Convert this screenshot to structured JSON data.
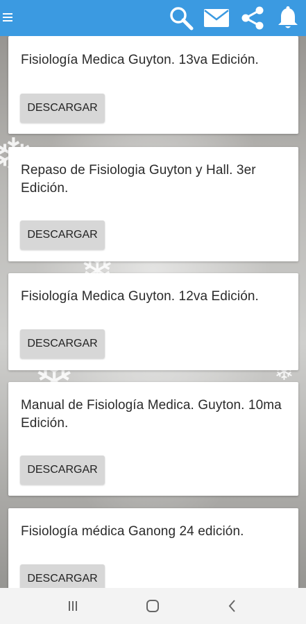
{
  "toolbar": {
    "icons": [
      "menu-icon",
      "search-icon",
      "mail-icon",
      "share-icon",
      "bell-icon"
    ],
    "color": "#3b9ae1"
  },
  "books": [
    {
      "title": "Fisiología Medica Guyton. 13va Edición.",
      "button": "DESCARGAR"
    },
    {
      "title": "Repaso de Fisiologia Guyton y Hall. 3er Edición.",
      "button": "DESCARGAR"
    },
    {
      "title": "Fisiología Medica Guyton. 12va Edición.",
      "button": "DESCARGAR"
    },
    {
      "title": "Manual de Fisiología Medica. Guyton. 10ma Edición.",
      "button": "DESCARGAR"
    },
    {
      "title": "Fisiología médica Ganong 24 edición.",
      "button": "DESCARGAR"
    }
  ],
  "navbar": {
    "icons": [
      "recent-apps-icon",
      "home-icon",
      "back-icon"
    ]
  }
}
